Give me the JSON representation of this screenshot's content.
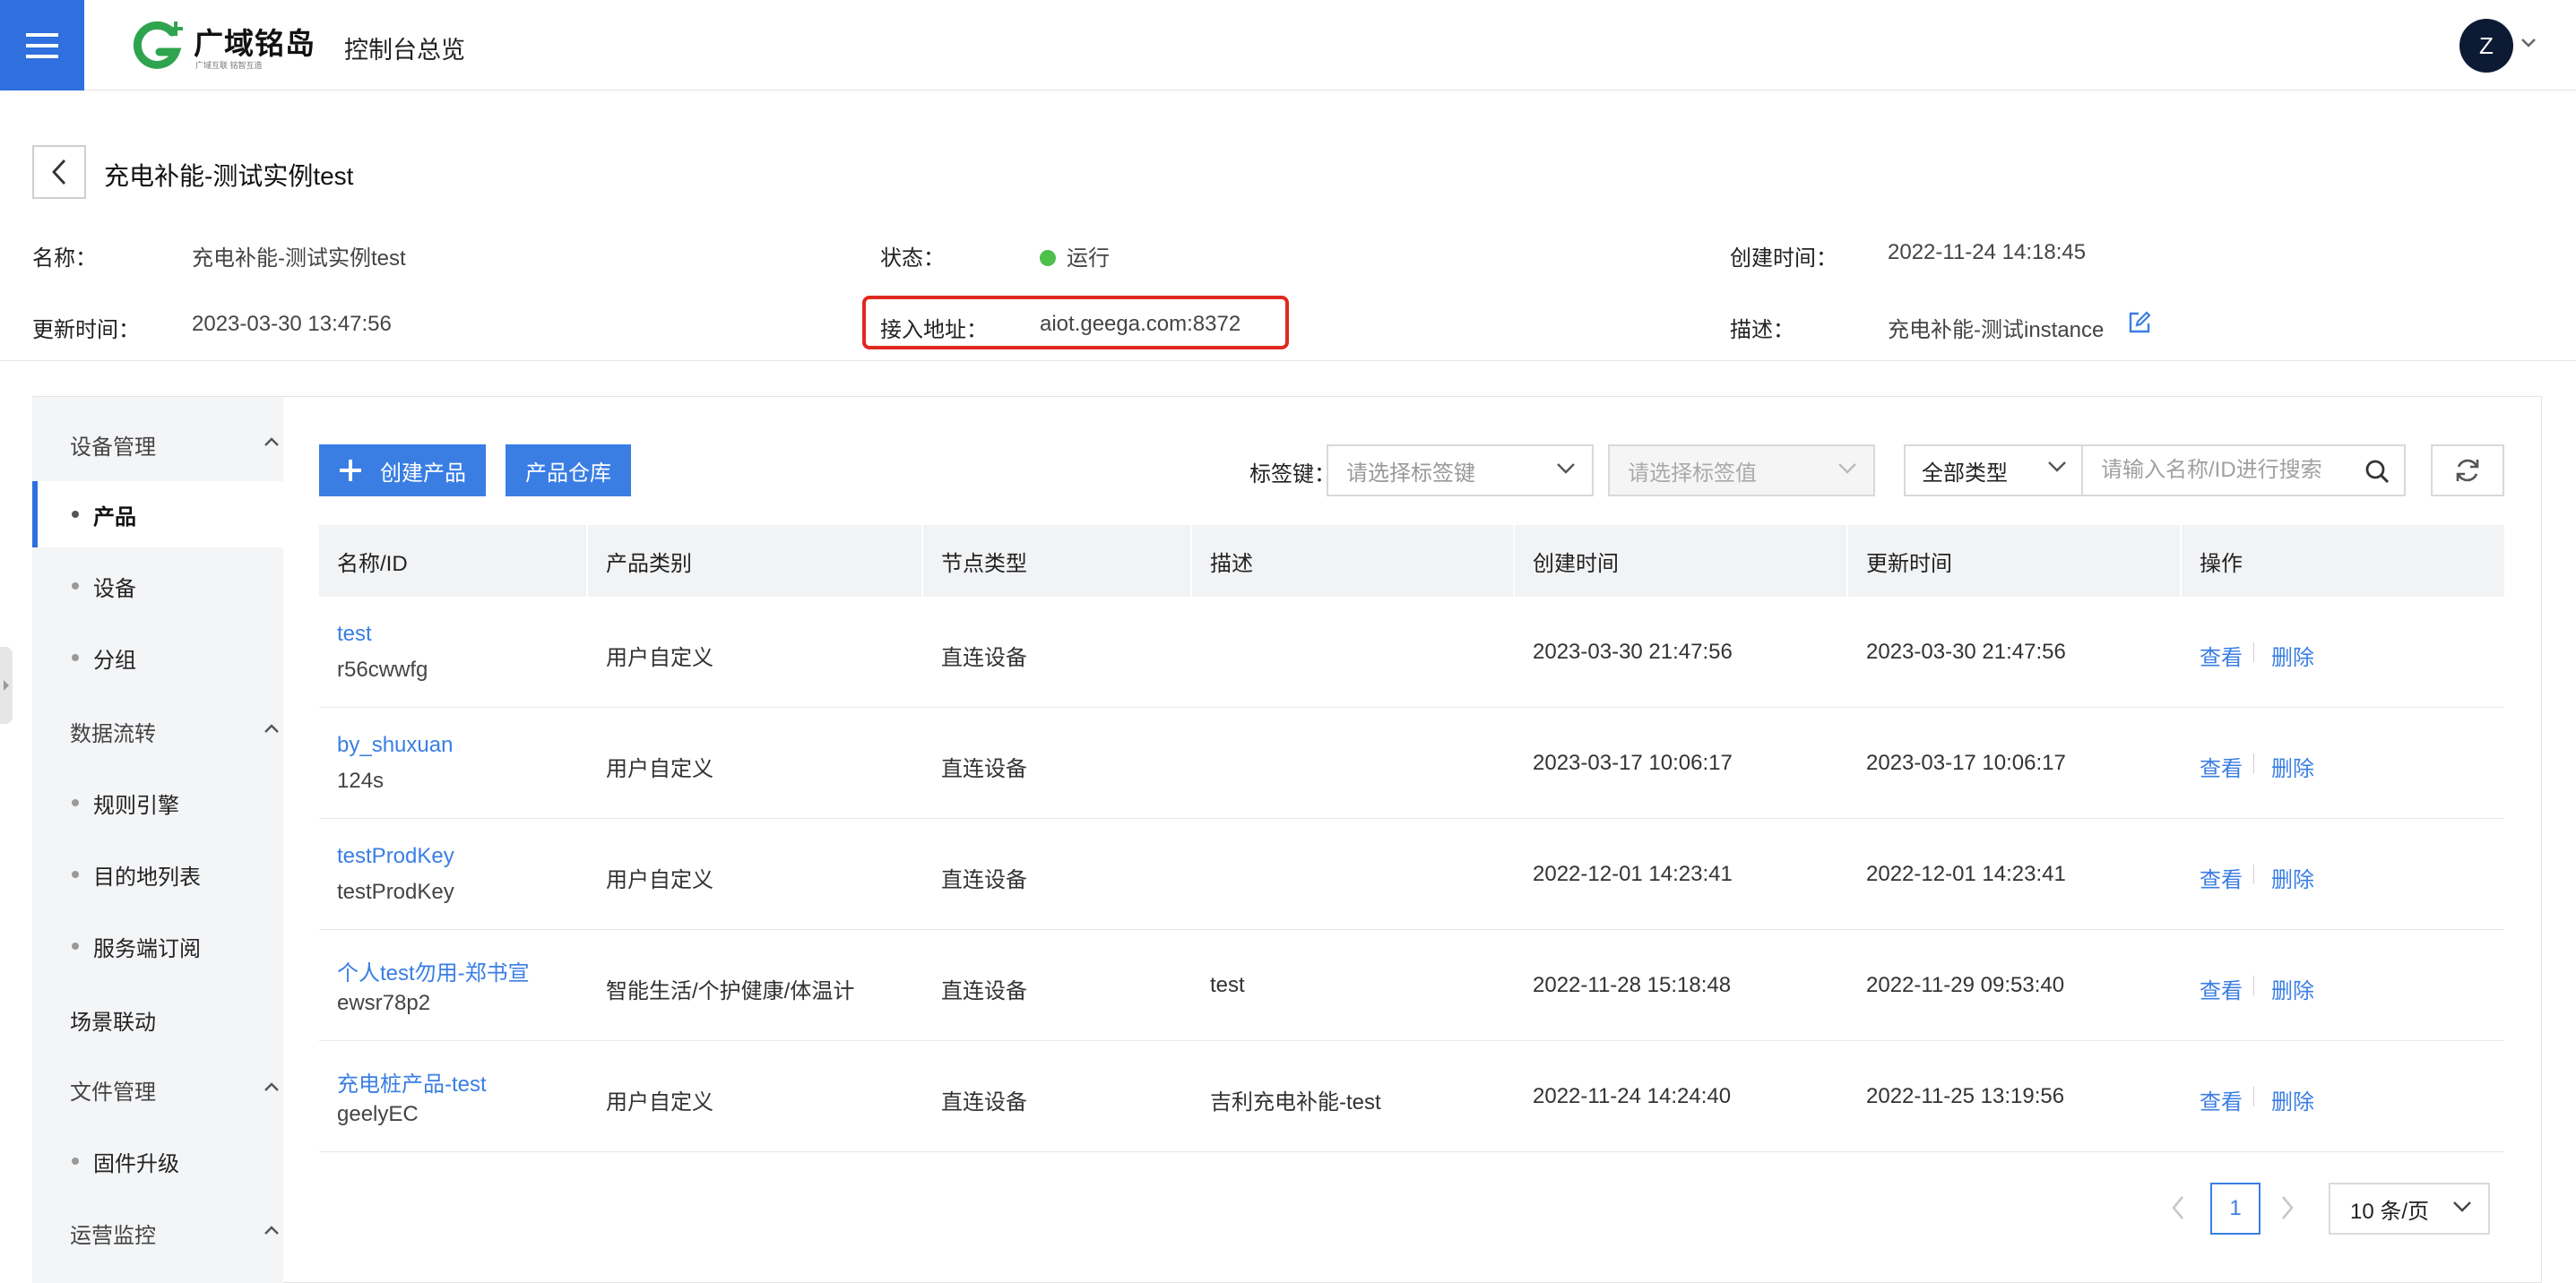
{
  "topbar": {
    "brand_name": "广域铭岛",
    "brand_tagline": "广域互联 铭智互造",
    "console_title": "控制台总览",
    "user_initial": "Z"
  },
  "header": {
    "title": "充电补能-测试实例test",
    "fields": {
      "name_label": "名称：",
      "name_value": "充电补能-测试实例test",
      "status_label": "状态：",
      "status_value": "运行",
      "created_label": "创建时间：",
      "created_value": "2022-11-24 14:18:45",
      "updated_label": "更新时间：",
      "updated_value": "2023-03-30 13:47:56",
      "endpoint_label": "接入地址：",
      "endpoint_value": "aiot.geega.com:8372",
      "desc_label": "描述：",
      "desc_value": "充电补能-测试instance"
    },
    "status_color": "#4cbf4c",
    "highlight_color": "#e0291f"
  },
  "sidebar": {
    "groups": [
      {
        "label": "设备管理",
        "items": [
          "产品",
          "设备",
          "分组"
        ]
      },
      {
        "label": "数据流转",
        "items": [
          "规则引擎",
          "目的地列表",
          "服务端订阅"
        ]
      },
      {
        "label": "场景联动",
        "items": []
      },
      {
        "label": "文件管理",
        "items": [
          "固件升级"
        ]
      },
      {
        "label": "运营监控",
        "items": []
      }
    ],
    "active_item": "产品"
  },
  "toolbar": {
    "create_label": "创建产品",
    "warehouse_label": "产品仓库",
    "tag_key_label": "标签键：",
    "tag_key_placeholder": "请选择标签键",
    "tag_value_placeholder": "请选择标签值",
    "type_selected": "全部类型",
    "search_placeholder": "请输入名称/ID进行搜索"
  },
  "table": {
    "columns": [
      "名称/ID",
      "产品类别",
      "节点类型",
      "描述",
      "创建时间",
      "更新时间",
      "操作"
    ],
    "view_label": "查看",
    "delete_label": "删除",
    "rows": [
      {
        "name": "test",
        "id": "r56cwwfg",
        "category": "用户自定义",
        "node_type": "直连设备",
        "desc": "",
        "created": "2023-03-30 21:47:56",
        "updated": "2023-03-30 21:47:56"
      },
      {
        "name": "by_shuxuan",
        "id": "124s",
        "category": "用户自定义",
        "node_type": "直连设备",
        "desc": "",
        "created": "2023-03-17 10:06:17",
        "updated": "2023-03-17 10:06:17"
      },
      {
        "name": "testProdKey",
        "id": "testProdKey",
        "category": "用户自定义",
        "node_type": "直连设备",
        "desc": "",
        "created": "2022-12-01 14:23:41",
        "updated": "2022-12-01 14:23:41"
      },
      {
        "name": "个人test勿用-郑书宣",
        "id": "ewsr78p2",
        "category": "智能生活/个护健康/体温计",
        "node_type": "直连设备",
        "desc": "test",
        "created": "2022-11-28 15:18:48",
        "updated": "2022-11-29 09:53:40"
      },
      {
        "name": "充电桩产品-test",
        "id": "geelyEC",
        "category": "用户自定义",
        "node_type": "直连设备",
        "desc": "吉利充电补能-test",
        "created": "2022-11-24 14:24:40",
        "updated": "2022-11-25 13:19:56"
      }
    ]
  },
  "pagination": {
    "current_page": "1",
    "page_size": "10 条/页"
  },
  "colors": {
    "primary": "#3a7ee4",
    "menu_bg": "#2f6fde",
    "brand_green": "#2ea44f"
  }
}
